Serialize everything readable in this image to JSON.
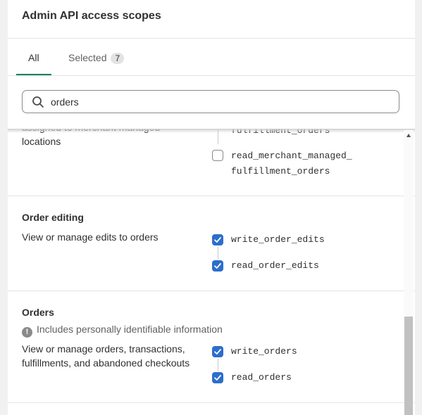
{
  "panel": {
    "title": "Admin API access scopes"
  },
  "tabs": [
    {
      "label": "All"
    },
    {
      "label": "Selected",
      "count": "7"
    }
  ],
  "search": {
    "value": "orders"
  },
  "sections": {
    "merchant_managed": {
      "desc_line1": "assigned to merchant managed",
      "desc_line2": "locations",
      "scope_fulfillment_partial": "fulfillment_orders",
      "scope_read_line1": "read_merchant_managed_",
      "scope_read_line2": "fulfillment_orders"
    },
    "order_editing": {
      "title": "Order editing",
      "description": "View or manage edits to orders",
      "scopes": [
        "write_order_edits",
        "read_order_edits"
      ]
    },
    "orders": {
      "title": "Orders",
      "warning": "Includes personally identifiable information",
      "desc_line1": "View or manage orders, transactions,",
      "desc_line2": "fulfillments, and abandoned checkouts",
      "scopes": [
        "write_orders",
        "read_orders"
      ]
    }
  },
  "icons": {
    "search": "search-icon",
    "warning": "alert-circle-icon",
    "check": "checkmark-icon"
  },
  "colors": {
    "accent": "#008060",
    "checkbox": "#2c6ecb"
  }
}
